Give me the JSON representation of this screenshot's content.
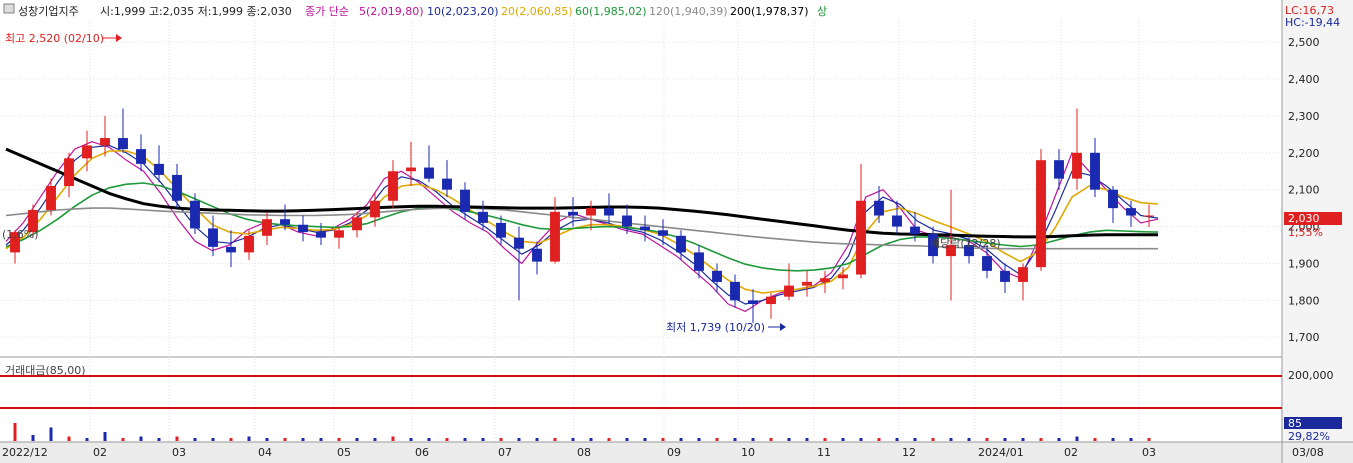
{
  "header": {
    "title": "성창기업지주",
    "ohlc": "시:1,999 고:2,035 저:1,999 종:2,030",
    "price_type": "종가 단순",
    "ma": [
      {
        "label": "5(2,019,80)",
        "color": "#c0119c"
      },
      {
        "label": "10(2,023,20)",
        "color": "#1a2a9c"
      },
      {
        "label": "20(2,060,85)",
        "color": "#e0a800"
      },
      {
        "label": "60(1,985,02)",
        "color": "#1e9a3a"
      },
      {
        "label": "120(1,940,39)",
        "color": "#8a8a8a"
      },
      {
        "label": "200(1,978,37)",
        "color": "#000000"
      }
    ],
    "tail": "상"
  },
  "right_panel": {
    "lc": "LC:16,73",
    "hc": "HC:-19,44",
    "current_price": "2,030",
    "current_pct": "1,55%",
    "volume_value": "85",
    "volume_pct": "29,82%"
  },
  "annotations": {
    "high": "최고 2,520 (02/10)",
    "low": "최저 1,739 (10/20)",
    "left_pct": "(1,6%)",
    "ex_dividend": "배당락(12/28)"
  },
  "volume_panel": {
    "label": "거래대금(85,00)",
    "axis_label": "200,000"
  },
  "chart_data": {
    "type": "candlestick",
    "title": "성창기업지주",
    "y_ticks": [
      "2,500",
      "2,400",
      "2,300",
      "2,200",
      "2,100",
      "2,000",
      "1,900",
      "1,800",
      "1,700"
    ],
    "ylim": [
      1660,
      2560
    ],
    "x_ticks": [
      "2022/12",
      "02",
      "03",
      "04",
      "05",
      "06",
      "07",
      "08",
      "09",
      "10",
      "11",
      "12",
      "2024/01",
      "02",
      "03",
      "03/08"
    ],
    "grid": true,
    "series": [
      {
        "name": "5",
        "values": [
          1960,
          2010,
          2080,
          2150,
          2210,
          2230,
          2215,
          2180,
          2150,
          2090,
          2020,
          1960,
          1935,
          1950,
          1990,
          2010,
          2005,
          1985,
          1975,
          1995,
          2020,
          2060,
          2130,
          2150,
          2120,
          2080,
          2040,
          2010,
          1985,
          1940,
          1900,
          1960,
          2010,
          2035,
          2020,
          2005,
          1990,
          1980,
          1950,
          1920,
          1880,
          1840,
          1790,
          1770,
          1800,
          1820,
          1830,
          1840,
          1875,
          1950,
          2080,
          2100,
          2050,
          1990,
          1975,
          1970,
          1960,
          1930,
          1880,
          1860,
          1960,
          2080,
          2200,
          2150,
          2100,
          2050,
          2010,
          2020
        ]
      },
      {
        "name": "10",
        "values": [
          1950,
          1990,
          2050,
          2120,
          2180,
          2215,
          2220,
          2200,
          2170,
          2120,
          2060,
          2000,
          1960,
          1955,
          1970,
          1995,
          2005,
          1995,
          1985,
          1990,
          2010,
          2045,
          2105,
          2135,
          2125,
          2095,
          2055,
          2025,
          1995,
          1960,
          1925,
          1950,
          1990,
          2015,
          2020,
          2010,
          1995,
          1985,
          1965,
          1935,
          1900,
          1855,
          1815,
          1790,
          1800,
          1815,
          1825,
          1835,
          1860,
          1920,
          2040,
          2080,
          2060,
          2015,
          1990,
          1980,
          1965,
          1940,
          1900,
          1870,
          1940,
          2040,
          2150,
          2140,
          2110,
          2070,
          2030,
          2023
        ]
      },
      {
        "name": "20",
        "values": [
          1940,
          1970,
          2020,
          2080,
          2140,
          2185,
          2205,
          2205,
          2190,
          2150,
          2100,
          2050,
          2005,
          1985,
          1980,
          1990,
          1998,
          1995,
          1990,
          1992,
          2005,
          2030,
          2080,
          2110,
          2115,
          2100,
          2075,
          2045,
          2015,
          1985,
          1960,
          1955,
          1975,
          1995,
          2005,
          2005,
          2000,
          1992,
          1980,
          1955,
          1925,
          1890,
          1855,
          1830,
          1820,
          1825,
          1830,
          1838,
          1852,
          1890,
          1985,
          2040,
          2050,
          2035,
          2015,
          1998,
          1980,
          1960,
          1930,
          1905,
          1930,
          1995,
          2080,
          2110,
          2100,
          2080,
          2065,
          2061
        ]
      },
      {
        "name": "60",
        "values": [
          1945,
          1965,
          1990,
          2020,
          2055,
          2085,
          2105,
          2115,
          2118,
          2110,
          2095,
          2075,
          2055,
          2035,
          2020,
          2010,
          2005,
          2002,
          2000,
          1998,
          2000,
          2008,
          2025,
          2040,
          2050,
          2052,
          2048,
          2040,
          2030,
          2018,
          2005,
          1995,
          1992,
          1995,
          1998,
          2000,
          1998,
          1993,
          1985,
          1972,
          1955,
          1935,
          1915,
          1898,
          1888,
          1882,
          1880,
          1882,
          1888,
          1900,
          1925,
          1950,
          1965,
          1972,
          1972,
          1968,
          1962,
          1956,
          1950,
          1946,
          1950,
          1962,
          1975,
          1985,
          1990,
          1988,
          1986,
          1985
        ]
      },
      {
        "name": "120",
        "values": [
          2030,
          2035,
          2040,
          2045,
          2048,
          2050,
          2050,
          2048,
          2045,
          2042,
          2040,
          2038,
          2036,
          2034,
          2032,
          2031,
          2030,
          2030,
          2030,
          2031,
          2033,
          2036,
          2040,
          2044,
          2047,
          2049,
          2050,
          2050,
          2048,
          2045,
          2040,
          2035,
          2030,
          2025,
          2020,
          2015,
          2010,
          2005,
          2000,
          1995,
          1990,
          1985,
          1980,
          1975,
          1970,
          1966,
          1962,
          1958,
          1955,
          1953,
          1952,
          1950,
          1949,
          1948,
          1946,
          1944,
          1942,
          1941,
          1940,
          1940,
          1940,
          1940,
          1940,
          1940,
          1940,
          1940,
          1940,
          1940
        ]
      },
      {
        "name": "200",
        "values": [
          2210,
          2190,
          2170,
          2150,
          2130,
          2110,
          2090,
          2075,
          2062,
          2055,
          2050,
          2047,
          2045,
          2044,
          2043,
          2042,
          2042,
          2043,
          2044,
          2046,
          2048,
          2050,
          2052,
          2054,
          2055,
          2055,
          2054,
          2053,
          2052,
          2051,
          2050,
          2050,
          2050,
          2051,
          2052,
          2053,
          2053,
          2052,
          2050,
          2046,
          2042,
          2037,
          2032,
          2026,
          2020,
          2014,
          2008,
          2002,
          1996,
          1990,
          1986,
          1982,
          1980,
          1979,
          1978,
          1977,
          1975,
          1974,
          1973,
          1972,
          1972,
          1973,
          1975,
          1977,
          1978,
          1978,
          1978,
          1978
        ]
      }
    ],
    "candles": [
      [
        1930,
        1990,
        1900,
        1985
      ],
      [
        1985,
        2060,
        1970,
        2045
      ],
      [
        2045,
        2130,
        2030,
        2110
      ],
      [
        2110,
        2200,
        2080,
        2185
      ],
      [
        2185,
        2260,
        2150,
        2220
      ],
      [
        2220,
        2300,
        2190,
        2240
      ],
      [
        2240,
        2320,
        2200,
        2210
      ],
      [
        2210,
        2250,
        2150,
        2170
      ],
      [
        2170,
        2220,
        2120,
        2140
      ],
      [
        2140,
        2170,
        2050,
        2070
      ],
      [
        2070,
        2090,
        1980,
        1995
      ],
      [
        1995,
        2030,
        1920,
        1945
      ],
      [
        1945,
        1990,
        1890,
        1930
      ],
      [
        1930,
        1990,
        1910,
        1975
      ],
      [
        1975,
        2040,
        1950,
        2020
      ],
      [
        2020,
        2060,
        1990,
        2005
      ],
      [
        2005,
        2030,
        1960,
        1985
      ],
      [
        1985,
        2010,
        1950,
        1970
      ],
      [
        1970,
        2000,
        1940,
        1990
      ],
      [
        1990,
        2040,
        1970,
        2025
      ],
      [
        2025,
        2090,
        2000,
        2070
      ],
      [
        2070,
        2180,
        2050,
        2150
      ],
      [
        2150,
        2230,
        2110,
        2160
      ],
      [
        2160,
        2220,
        2120,
        2130
      ],
      [
        2130,
        2180,
        2080,
        2100
      ],
      [
        2100,
        2120,
        2020,
        2040
      ],
      [
        2040,
        2070,
        1990,
        2010
      ],
      [
        2010,
        2030,
        1950,
        1970
      ],
      [
        1970,
        2000,
        1800,
        1940
      ],
      [
        1940,
        1960,
        1870,
        1905
      ],
      [
        1905,
        2080,
        1900,
        2040
      ],
      [
        2040,
        2080,
        2000,
        2030
      ],
      [
        2030,
        2070,
        1990,
        2050
      ],
      [
        2050,
        2090,
        2010,
        2030
      ],
      [
        2030,
        2060,
        1980,
        2000
      ],
      [
        2000,
        2030,
        1960,
        1990
      ],
      [
        1990,
        2020,
        1950,
        1975
      ],
      [
        1975,
        1990,
        1910,
        1930
      ],
      [
        1930,
        1950,
        1860,
        1880
      ],
      [
        1880,
        1900,
        1820,
        1850
      ],
      [
        1850,
        1870,
        1780,
        1800
      ],
      [
        1800,
        1830,
        1739,
        1790
      ],
      [
        1790,
        1820,
        1750,
        1810
      ],
      [
        1810,
        1900,
        1800,
        1840
      ],
      [
        1840,
        1880,
        1810,
        1850
      ],
      [
        1850,
        1880,
        1820,
        1860
      ],
      [
        1860,
        1890,
        1830,
        1870
      ],
      [
        1870,
        2170,
        1860,
        2070
      ],
      [
        2070,
        2110,
        2010,
        2030
      ],
      [
        2030,
        2070,
        1980,
        2000
      ],
      [
        2000,
        2040,
        1960,
        1980
      ],
      [
        1980,
        2000,
        1900,
        1920
      ],
      [
        1920,
        2100,
        1800,
        1950
      ],
      [
        1950,
        1980,
        1900,
        1920
      ],
      [
        1920,
        1950,
        1860,
        1880
      ],
      [
        1880,
        1900,
        1820,
        1850
      ],
      [
        1850,
        1900,
        1800,
        1890
      ],
      [
        1890,
        2210,
        1880,
        2180
      ],
      [
        2180,
        2210,
        2100,
        2130
      ],
      [
        2130,
        2320,
        2100,
        2200
      ],
      [
        2200,
        2240,
        2080,
        2100
      ],
      [
        2100,
        2110,
        2010,
        2050
      ],
      [
        2050,
        2070,
        1999,
        2030
      ],
      [
        2030,
        2060,
        1999,
        2030
      ]
    ],
    "volume": [
      12,
      4,
      9,
      3,
      2,
      6,
      2,
      3,
      2,
      3,
      2,
      2,
      2,
      3,
      2,
      2,
      2,
      2,
      2,
      2,
      2,
      3,
      2,
      2,
      2,
      2,
      2,
      2,
      2,
      2,
      2,
      2,
      2,
      2,
      2,
      2,
      2,
      2,
      2,
      2,
      2,
      2,
      2,
      2,
      2,
      2,
      2,
      2,
      2,
      2,
      2,
      2,
      2,
      2,
      2,
      2,
      2,
      2,
      2,
      3,
      2,
      2,
      2,
      2
    ]
  }
}
